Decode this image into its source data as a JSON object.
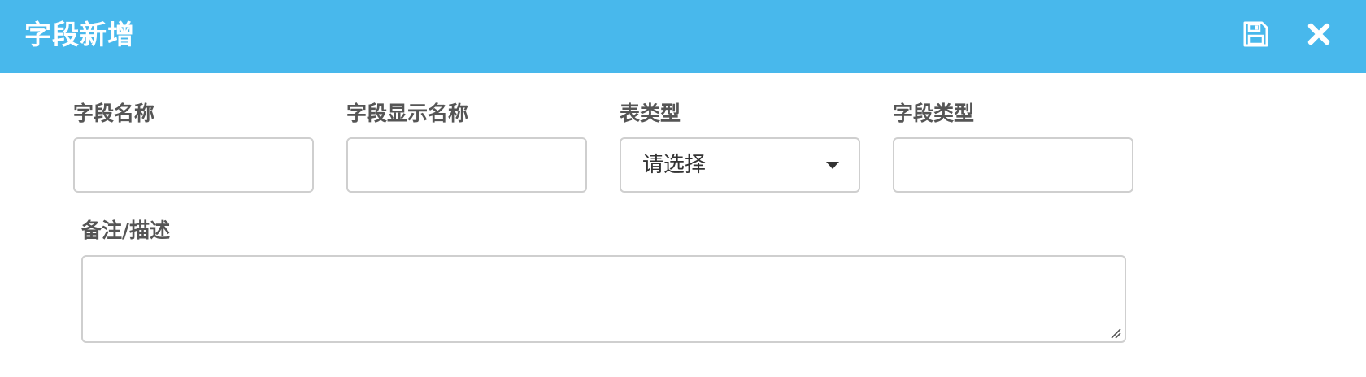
{
  "dialog": {
    "title": "字段新增",
    "save_icon": "save-icon",
    "close_icon": "close-icon"
  },
  "form": {
    "field_name": {
      "label": "字段名称",
      "value": ""
    },
    "display_name": {
      "label": "字段显示名称",
      "value": ""
    },
    "table_type": {
      "label": "表类型",
      "selected": "请选择"
    },
    "field_type": {
      "label": "字段类型",
      "value": ""
    },
    "remark": {
      "label": "备注/描述",
      "value": ""
    }
  },
  "colors": {
    "header_bg": "#48b8ec",
    "label_text": "#555555",
    "border": "#cfcfcf"
  }
}
